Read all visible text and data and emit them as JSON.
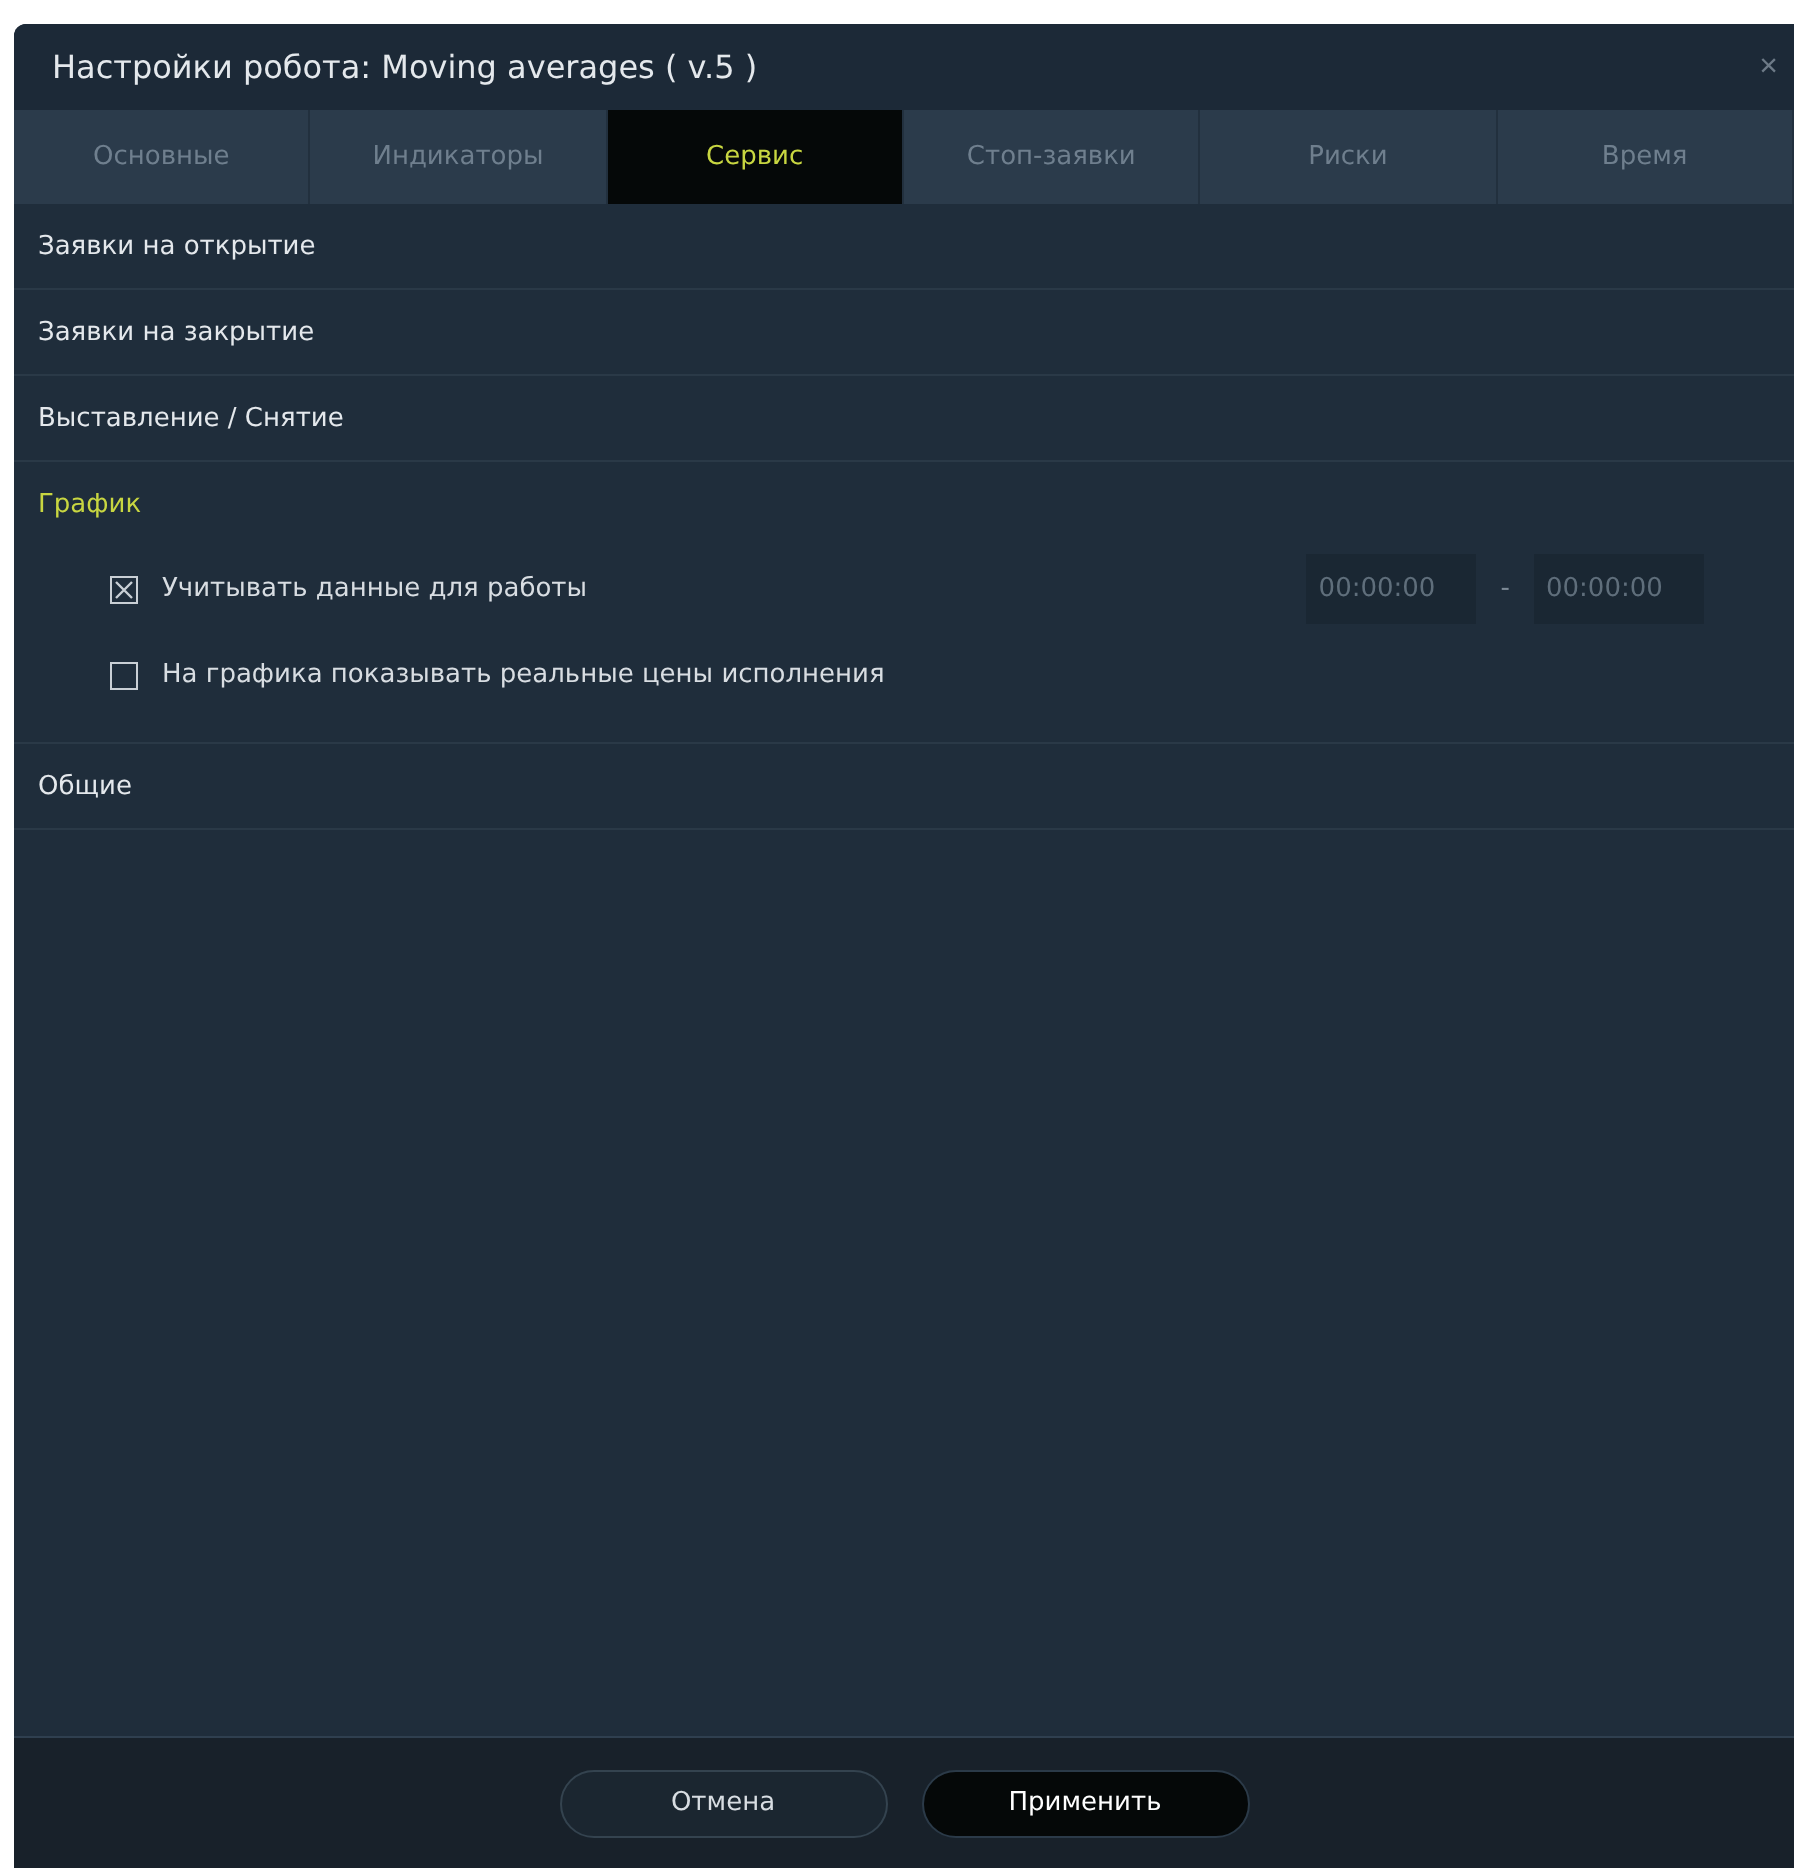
{
  "window": {
    "title": "Настройки робота: Moving averages ( v.5 )",
    "close": "×"
  },
  "tabs": [
    {
      "label": "Основные",
      "selected": false
    },
    {
      "label": "Индикаторы",
      "selected": false
    },
    {
      "label": "Сервис",
      "selected": true
    },
    {
      "label": "Стоп-заявки",
      "selected": false
    },
    {
      "label": "Риски",
      "selected": false
    },
    {
      "label": "Время",
      "selected": false
    }
  ],
  "sections": [
    {
      "title": "Заявки на открытие",
      "expanded": false
    },
    {
      "title": "Заявки на закрытие",
      "expanded": false
    },
    {
      "title": "Выставление / Снятие",
      "expanded": false
    },
    {
      "title": "График",
      "expanded": true,
      "items": [
        {
          "label": "Учитывать данные для работы",
          "checked": true,
          "time_from": "00:00:00",
          "separator": "-",
          "time_to": "00:00:00"
        },
        {
          "label": "На графика показывать реальные цены исполнения",
          "checked": false
        }
      ]
    },
    {
      "title": "Общие",
      "expanded": false
    }
  ],
  "buttons": [
    {
      "label": "Отмена",
      "kind": "secondary"
    },
    {
      "label": "Применить",
      "kind": "primary"
    }
  ]
}
